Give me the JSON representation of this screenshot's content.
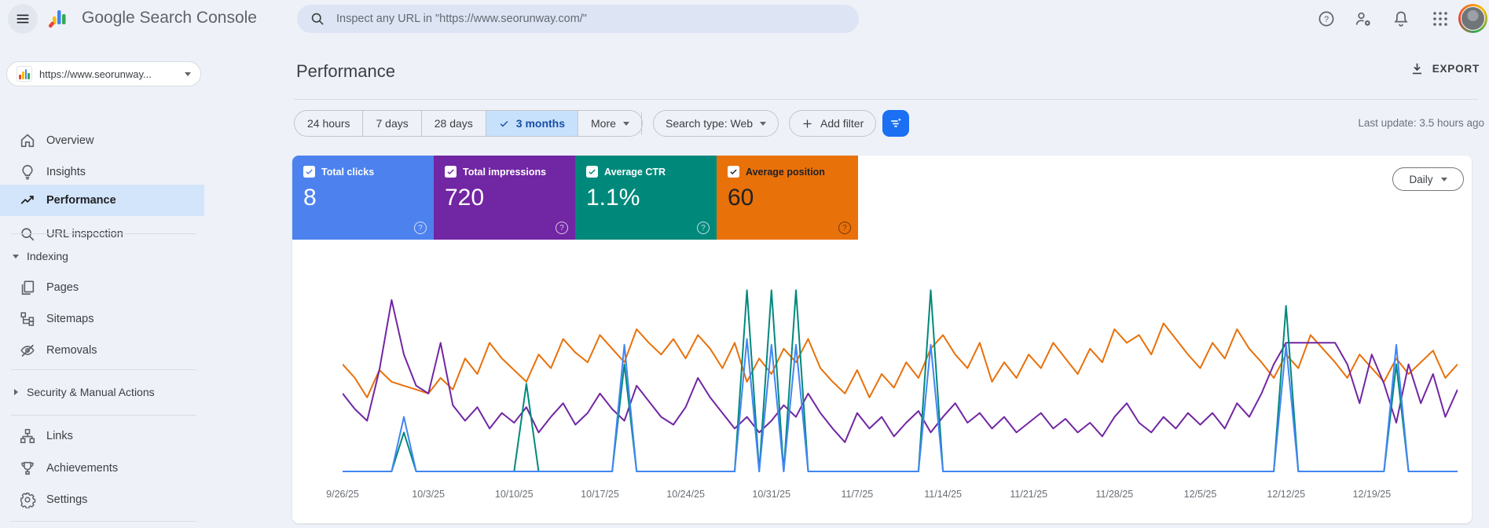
{
  "topbar": {
    "product_name": "Google Search Console",
    "search_placeholder": "Inspect any URL in \"https://www.seorunway.com/\""
  },
  "sidebar": {
    "property_label": "https://www.seorunway...",
    "nav": [
      {
        "label": "Overview",
        "icon": "home-icon"
      },
      {
        "label": "Insights",
        "icon": "lightbulb-icon"
      },
      {
        "label": "Performance",
        "icon": "performance-trend-icon",
        "selected": true
      },
      {
        "label": "URL inspection",
        "icon": "search-icon"
      }
    ],
    "indexing_header": "Indexing",
    "indexing_items": [
      {
        "label": "Pages",
        "icon": "pages-icon"
      },
      {
        "label": "Sitemaps",
        "icon": "sitemap-icon"
      },
      {
        "label": "Removals",
        "icon": "eye-off-icon"
      }
    ],
    "security_header": "Security & Manual Actions",
    "bottom_items": [
      {
        "label": "Links",
        "icon": "links-tree-icon"
      },
      {
        "label": "Achievements",
        "icon": "trophy-icon"
      },
      {
        "label": "Settings",
        "icon": "gear-icon"
      }
    ]
  },
  "header": {
    "title": "Performance",
    "export_label": "EXPORT"
  },
  "filters": {
    "date_ranges": [
      "24 hours",
      "7 days",
      "28 days",
      "3 months"
    ],
    "selected_range": "3 months",
    "more_label": "More",
    "search_type_label": "Search type: Web",
    "add_filter_label": "Add filter",
    "last_update": "Last update: 3.5 hours ago"
  },
  "metrics": {
    "cards": [
      {
        "label": "Total clicks",
        "value": "8",
        "color": "#4d82ee",
        "text_color": "#ffffff",
        "check_color": "#4d82ee",
        "help_color": "rgba(255,255,255,0.75)"
      },
      {
        "label": "Total impressions",
        "value": "720",
        "color": "#7126a3",
        "text_color": "#ffffff",
        "check_color": "#7126a3",
        "help_color": "rgba(255,255,255,0.75)"
      },
      {
        "label": "Average CTR",
        "value": "1.1%",
        "color": "#00897b",
        "text_color": "#ffffff",
        "check_color": "#00897b",
        "help_color": "rgba(255,255,255,0.75)"
      },
      {
        "label": "Average position",
        "value": "60",
        "color": "#e8710a",
        "text_color": "#202124",
        "check_color": "#202124",
        "help_color": "rgba(0,0,0,0.5)"
      }
    ]
  },
  "chart_controls": {
    "granularity": "Daily"
  },
  "chart_data": {
    "type": "line",
    "x_start": "9/26/25",
    "x_end": "12/26/25",
    "num_days": 92,
    "x_labels": [
      "9/26/25",
      "10/3/25",
      "10/10/25",
      "10/17/25",
      "10/24/25",
      "10/31/25",
      "11/7/25",
      "11/14/25",
      "11/21/25",
      "11/28/25",
      "12/5/25",
      "12/12/25",
      "12/19/25"
    ],
    "label_day_indices": [
      0,
      7,
      14,
      21,
      28,
      35,
      42,
      49,
      56,
      63,
      70,
      77,
      84
    ],
    "y_axis": "hidden (values are percent of plot height, 0-100)",
    "grid": "off",
    "legend_position": "none (legend lives in metric cards)",
    "series": [
      {
        "id": "position",
        "name": "Average position",
        "color": "#e8710a",
        "average": "60",
        "values": [
          55,
          48,
          38,
          52,
          46,
          44,
          42,
          40,
          48,
          42,
          58,
          50,
          66,
          58,
          52,
          46,
          60,
          53,
          68,
          61,
          56,
          70,
          63,
          56,
          73,
          66,
          60,
          68,
          58,
          70,
          63,
          53,
          66,
          46,
          58,
          50,
          63,
          56,
          68,
          53,
          46,
          40,
          52,
          38,
          50,
          43,
          56,
          48,
          63,
          70,
          60,
          53,
          66,
          46,
          56,
          48,
          60,
          53,
          66,
          58,
          50,
          63,
          56,
          73,
          66,
          70,
          60,
          76,
          68,
          60,
          53,
          66,
          58,
          73,
          63,
          56,
          48,
          60,
          53,
          70,
          63,
          56,
          48,
          60,
          53,
          46,
          58,
          50,
          56,
          62,
          48,
          55
        ]
      },
      {
        "id": "impressions",
        "name": "Total impressions",
        "color": "#7126a3",
        "total": "720",
        "values": [
          40,
          32,
          26,
          52,
          88,
          60,
          44,
          40,
          66,
          34,
          26,
          33,
          22,
          30,
          25,
          33,
          20,
          28,
          35,
          24,
          30,
          40,
          32,
          26,
          44,
          36,
          28,
          24,
          33,
          48,
          38,
          30,
          22,
          28,
          20,
          26,
          34,
          28,
          40,
          30,
          22,
          15,
          30,
          22,
          28,
          18,
          25,
          31,
          20,
          28,
          35,
          25,
          30,
          22,
          28,
          20,
          25,
          30,
          22,
          27,
          20,
          25,
          18,
          28,
          35,
          25,
          20,
          28,
          22,
          30,
          24,
          30,
          22,
          35,
          28,
          40,
          55,
          66,
          66,
          66,
          66,
          66,
          55,
          35,
          60,
          45,
          25,
          55,
          35,
          50,
          28,
          42
        ]
      },
      {
        "id": "ctr",
        "name": "Average CTR",
        "color": "#00897b",
        "average": "1.1%",
        "values": [
          0,
          0,
          0,
          0,
          0,
          20,
          0,
          0,
          0,
          0,
          0,
          0,
          0,
          0,
          0,
          45,
          0,
          0,
          0,
          0,
          0,
          0,
          0,
          55,
          0,
          0,
          0,
          0,
          0,
          0,
          0,
          0,
          0,
          93,
          0,
          93,
          0,
          93,
          0,
          0,
          0,
          0,
          0,
          0,
          0,
          0,
          0,
          0,
          93,
          0,
          0,
          0,
          0,
          0,
          0,
          0,
          0,
          0,
          0,
          0,
          0,
          0,
          0,
          0,
          0,
          0,
          0,
          0,
          0,
          0,
          0,
          0,
          0,
          0,
          0,
          0,
          0,
          85,
          0,
          0,
          0,
          0,
          0,
          0,
          0,
          0,
          55,
          0,
          0,
          0,
          0,
          0
        ]
      },
      {
        "id": "clicks",
        "name": "Total clicks",
        "color": "#4285f4",
        "total": "8",
        "values": [
          0,
          0,
          0,
          0,
          0,
          28,
          0,
          0,
          0,
          0,
          0,
          0,
          0,
          0,
          0,
          0,
          0,
          0,
          0,
          0,
          0,
          0,
          0,
          65,
          0,
          0,
          0,
          0,
          0,
          0,
          0,
          0,
          0,
          68,
          0,
          65,
          0,
          65,
          0,
          0,
          0,
          0,
          0,
          0,
          0,
          0,
          0,
          0,
          65,
          0,
          0,
          0,
          0,
          0,
          0,
          0,
          0,
          0,
          0,
          0,
          0,
          0,
          0,
          0,
          0,
          0,
          0,
          0,
          0,
          0,
          0,
          0,
          0,
          0,
          0,
          0,
          0,
          65,
          0,
          0,
          0,
          0,
          0,
          0,
          0,
          0,
          65,
          0,
          0,
          0,
          0,
          0
        ]
      }
    ]
  }
}
